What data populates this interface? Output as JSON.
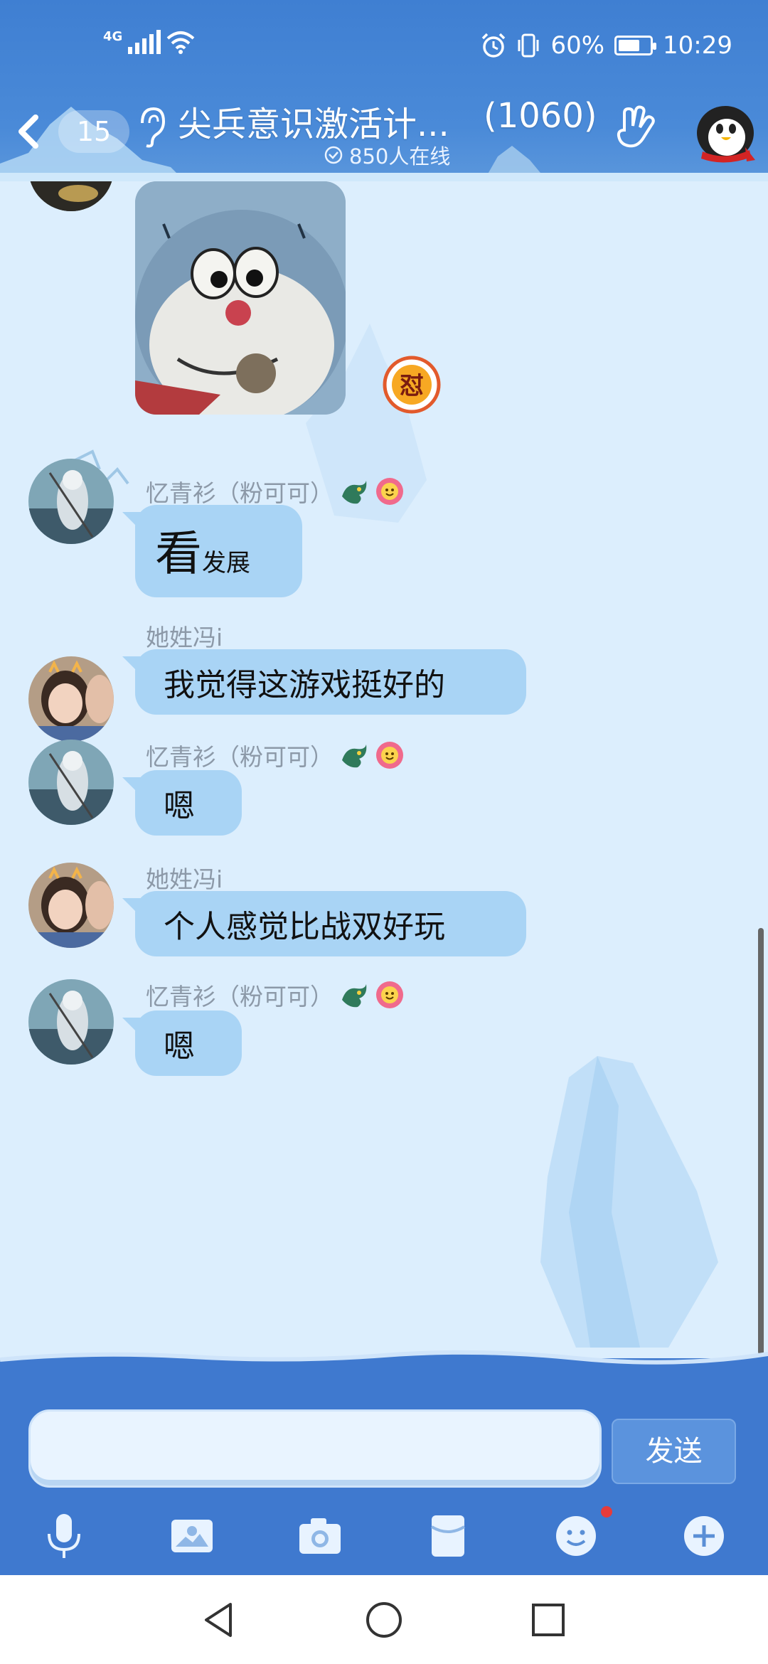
{
  "status_bar": {
    "network": "4G",
    "battery_text": "60%",
    "battery_level": 0.6,
    "time": "10:29"
  },
  "header": {
    "unread_count": "15",
    "group_name": "尖兵意识激活计...",
    "member_count": "(1060)",
    "online_text": "850人在线"
  },
  "messages": [
    {
      "type": "sticker",
      "icons": [
        "doraemon-sticker",
        "reaction-badge-icon"
      ]
    },
    {
      "sender": "忆青衫（粉可可）",
      "text_big": "看",
      "text_small": "发展",
      "badges": [
        "dragon-badge-icon",
        "flower-badge-icon"
      ]
    },
    {
      "sender": "她姓冯i",
      "text": "我觉得这游戏挺好的"
    },
    {
      "sender": "忆青衫（粉可可）",
      "text": "嗯",
      "badges": [
        "dragon-badge-icon",
        "flower-badge-icon"
      ]
    },
    {
      "sender": "她姓冯i",
      "text": "个人感觉比战双好玩"
    },
    {
      "sender": "忆青衫（粉可可）",
      "text": "嗯",
      "badges": [
        "dragon-badge-icon",
        "flower-badge-icon"
      ]
    }
  ],
  "input": {
    "placeholder": "",
    "send_label": "发送"
  },
  "toolbar_icons": [
    "microphone-icon",
    "image-icon",
    "camera-icon",
    "red-packet-icon",
    "emoji-icon",
    "plus-icon"
  ],
  "colors": {
    "header_blue": "#3f7fd2",
    "bubble": "#a9d4f5",
    "chat_bg": "#dceefd",
    "sender_gray": "#8c99a8"
  }
}
